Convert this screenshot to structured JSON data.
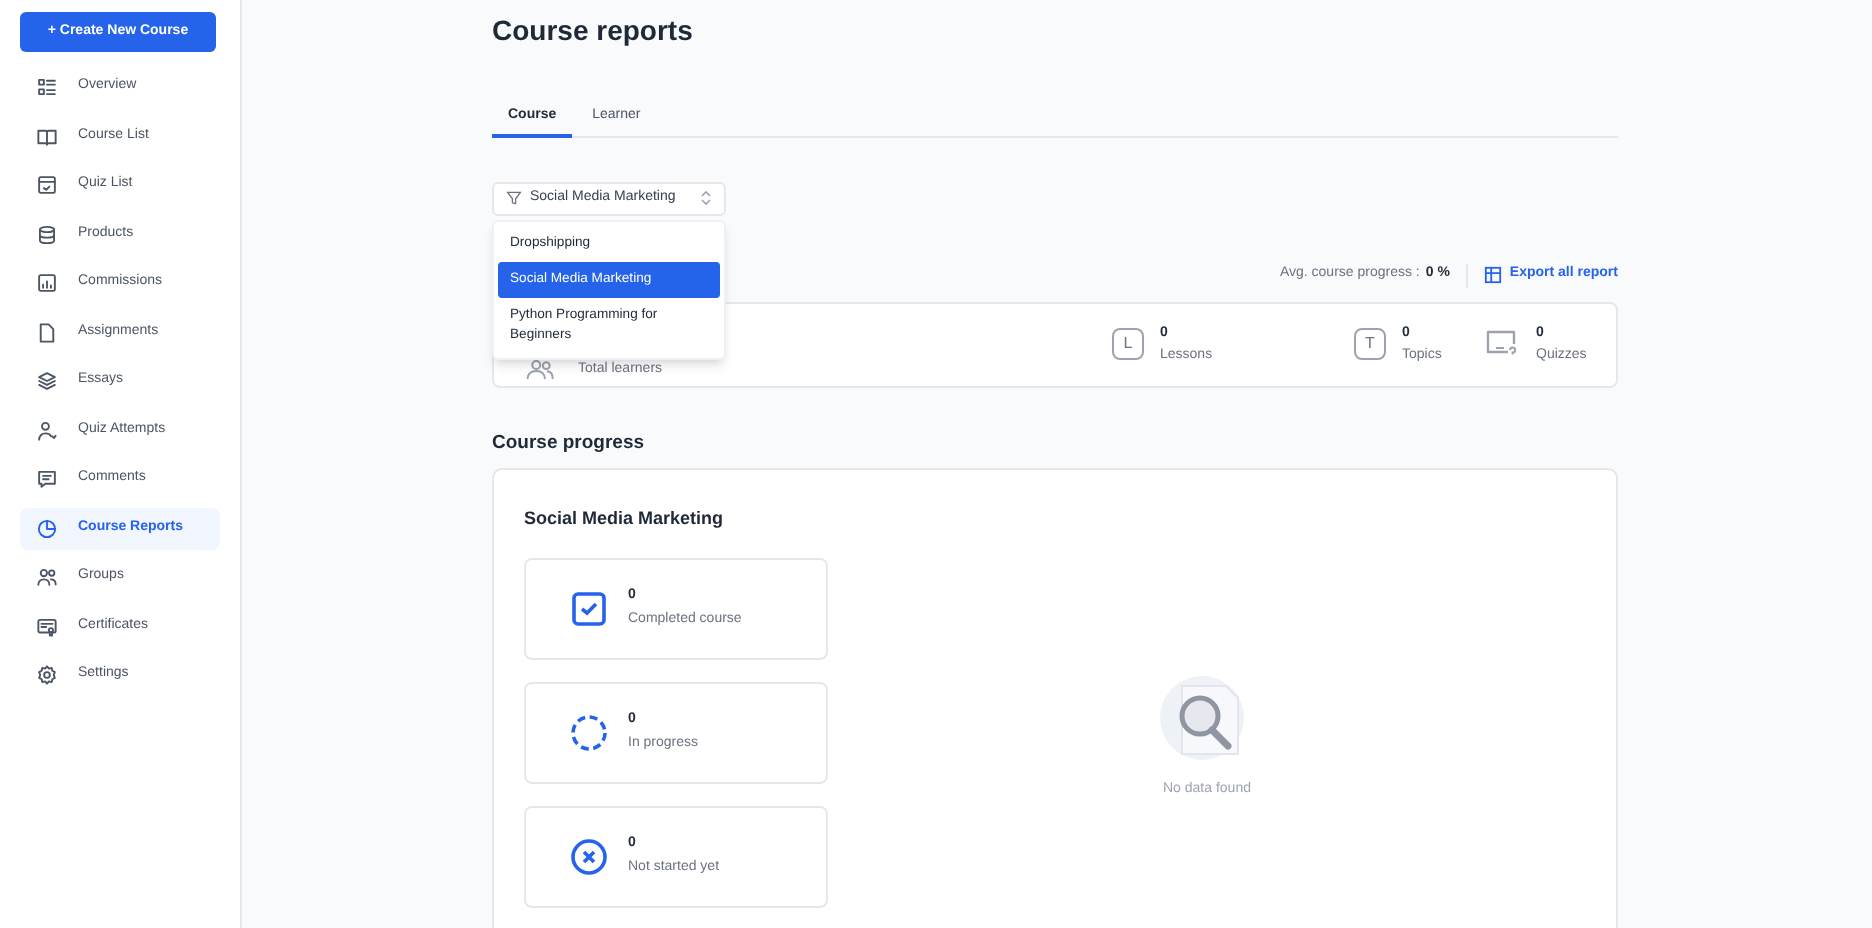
{
  "sidebar": {
    "create_button": "+ Create New Course",
    "items": [
      {
        "label": "Overview",
        "kind": "overview",
        "selected": false
      },
      {
        "label": "Course List",
        "kind": "book",
        "selected": false
      },
      {
        "label": "Quiz List",
        "kind": "quiz",
        "selected": false
      },
      {
        "label": "Products",
        "kind": "database",
        "selected": false
      },
      {
        "label": "Commissions",
        "kind": "chart",
        "selected": false
      },
      {
        "label": "Assignments",
        "kind": "file",
        "selected": false
      },
      {
        "label": "Essays",
        "kind": "layers",
        "selected": false
      },
      {
        "label": "Quiz Attempts",
        "kind": "user",
        "selected": false
      },
      {
        "label": "Comments",
        "kind": "comment",
        "selected": false
      },
      {
        "label": "Course Reports",
        "kind": "pie",
        "selected": true
      },
      {
        "label": "Groups",
        "kind": "users",
        "selected": false
      },
      {
        "label": "Certificates",
        "kind": "certificate",
        "selected": false
      },
      {
        "label": "Settings",
        "kind": "gear",
        "selected": false
      }
    ]
  },
  "title": "Course reports",
  "tabs": [
    {
      "label": "Course",
      "selected": true
    },
    {
      "label": "Learner",
      "selected": false
    }
  ],
  "course_select": {
    "value": "Social Media Marketing",
    "expanded": true,
    "options": [
      {
        "label": "Dropshipping",
        "selected": false
      },
      {
        "label": "Social Media Marketing",
        "selected": true
      },
      {
        "label": "Python Programming for Beginners",
        "selected": false
      }
    ]
  },
  "avg_progress": {
    "label": "Avg. course progress :",
    "value": "0 %"
  },
  "export_link": "Export all report",
  "stats": [
    {
      "kind": "learners",
      "label": "Total learners"
    },
    {
      "kind": "lessons",
      "icon_letter": "L",
      "value": "0",
      "label": "Lessons"
    },
    {
      "kind": "topics",
      "icon_letter": "T",
      "value": "0",
      "label": "Topics"
    },
    {
      "kind": "quizzes",
      "value": "0",
      "label": "Quizzes"
    }
  ],
  "progress_heading": "Course progress",
  "progress_card": {
    "course": "Social Media Marketing",
    "statuses": [
      {
        "kind": "completed",
        "value": "0",
        "label": "Completed course"
      },
      {
        "kind": "in_progress",
        "value": "0",
        "label": "In progress"
      },
      {
        "kind": "not_started",
        "value": "0",
        "label": "Not started yet"
      }
    ],
    "empty_text": "No data found"
  }
}
